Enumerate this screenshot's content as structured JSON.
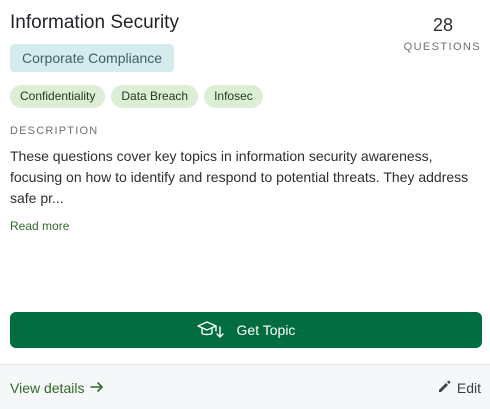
{
  "card": {
    "title": "Information Security",
    "question_count": "28",
    "question_count_label": "QUESTIONS",
    "category": "Corporate Compliance",
    "tags": [
      "Confidentiality",
      "Data Breach",
      "Infosec"
    ],
    "description_label": "DESCRIPTION",
    "description": "These questions cover key topics in information security awareness, focusing on how to identify and respond to potential threats. They address safe pr...",
    "read_more": "Read more",
    "primary_button": {
      "label": "Get Topic",
      "icon": "graduation-cap-download-icon"
    },
    "footer": {
      "view_details": "View details",
      "view_details_icon": "arrow-right-icon",
      "edit": "Edit",
      "edit_icon": "pencil-icon"
    }
  },
  "colors": {
    "accent": "#006c3f",
    "category_bg": "#d5ecee",
    "tag_bg": "#dcefd6",
    "link": "#2f6a2a"
  }
}
